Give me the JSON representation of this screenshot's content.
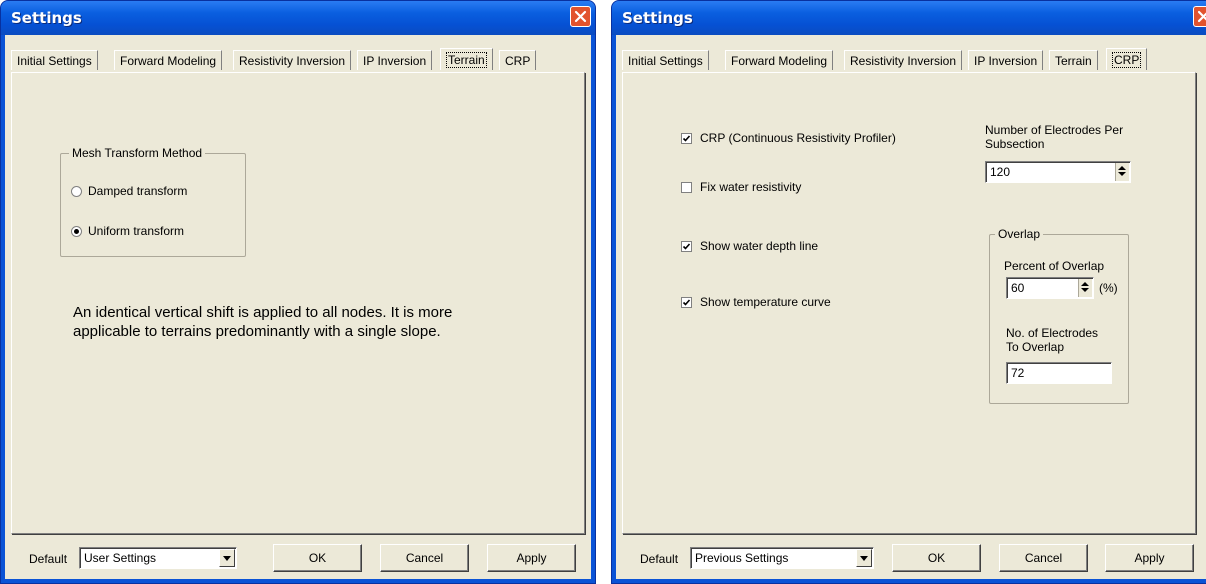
{
  "left_dialog": {
    "title": "Settings",
    "tabs": [
      "Initial Settings",
      "Forward Modeling",
      "Resistivity Inversion",
      "IP Inversion",
      "Terrain",
      "CRP"
    ],
    "active_tab": "Terrain",
    "mesh_group": {
      "label": "Mesh Transform Method",
      "options": [
        "Damped transform",
        "Uniform transform"
      ],
      "selected": "Uniform transform"
    },
    "description_line1": "An identical vertical shift is applied to all nodes. It is more",
    "description_line2": "applicable to terrains predominantly with a single slope.",
    "default_label": "Default",
    "default_value": "User Settings",
    "ok_label": "OK",
    "cancel_label": "Cancel",
    "apply_label": "Apply"
  },
  "right_dialog": {
    "title": "Settings",
    "tabs": [
      "Initial Settings",
      "Forward Modeling",
      "Resistivity Inversion",
      "IP Inversion",
      "Terrain",
      "CRP"
    ],
    "active_tab": "CRP",
    "checkboxes": [
      {
        "label": "CRP (Continuous Resistivity Profiler)",
        "checked": true
      },
      {
        "label": "Fix water resistivity",
        "checked": false
      },
      {
        "label": "Show water depth line",
        "checked": true
      },
      {
        "label": "Show temperature curve",
        "checked": true
      }
    ],
    "electrodes_label_line1": "Number of Electrodes Per",
    "electrodes_label_line2": "Subsection",
    "electrodes_value": "120",
    "overlap_group": {
      "label": "Overlap",
      "percent_label": "Percent of Overlap",
      "percent_value": "60",
      "percent_unit": "(%)",
      "electrodes_label_line1": "No. of Electrodes",
      "electrodes_label_line2": "To Overlap",
      "electrodes_value": "72"
    },
    "default_label": "Default",
    "default_value": "Previous Settings",
    "ok_label": "OK",
    "cancel_label": "Cancel",
    "apply_label": "Apply"
  },
  "colors": {
    "titlebar": "#0a5fe0",
    "dialog_bg": "#ece9d8",
    "close_button": "#e2532e"
  }
}
